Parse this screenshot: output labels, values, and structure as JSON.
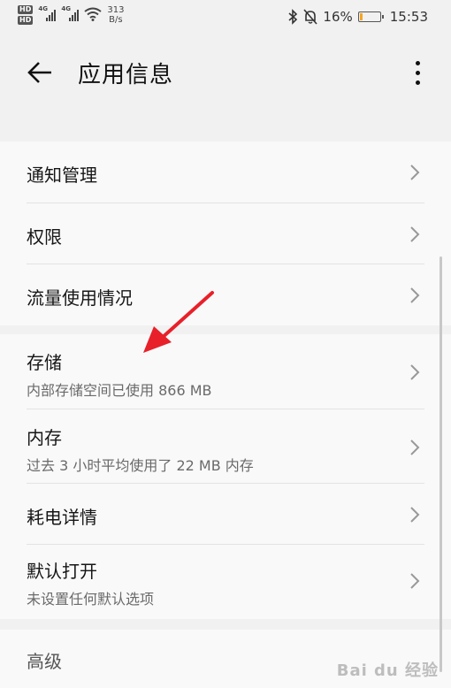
{
  "status_bar": {
    "hd1": "HD",
    "hd2": "HD",
    "net1": "4G",
    "net2": "4G",
    "speed_value": "313",
    "speed_unit": "B/s",
    "battery_percent": "16%",
    "battery_level": 0.16,
    "time": "15:53",
    "icons": [
      "bluetooth-icon",
      "mute-icon",
      "battery-icon",
      "wifi-icon",
      "signal-icon"
    ]
  },
  "header": {
    "title": "应用信息",
    "back_icon": "arrow-left-icon",
    "more_icon": "more-vertical-icon"
  },
  "group1": [
    {
      "label": "通知管理"
    },
    {
      "label": "权限"
    },
    {
      "label": "流量使用情况"
    }
  ],
  "group2": [
    {
      "label": "存储",
      "sub": "内部存储空间已使用 866 MB"
    },
    {
      "label": "内存",
      "sub": "过去 3 小时平均使用了 22 MB 内存"
    },
    {
      "label": "耗电详情"
    },
    {
      "label": "默认打开",
      "sub": "未设置任何默认选项"
    }
  ],
  "group3": [
    {
      "label": "高级"
    }
  ],
  "annotation": {
    "arrow_color": "#e8202a"
  },
  "watermark": "Bai du 经验",
  "colors": {
    "background": "#f1f1f1",
    "card": "#f9f9f9",
    "arrow": "#e8202a"
  }
}
